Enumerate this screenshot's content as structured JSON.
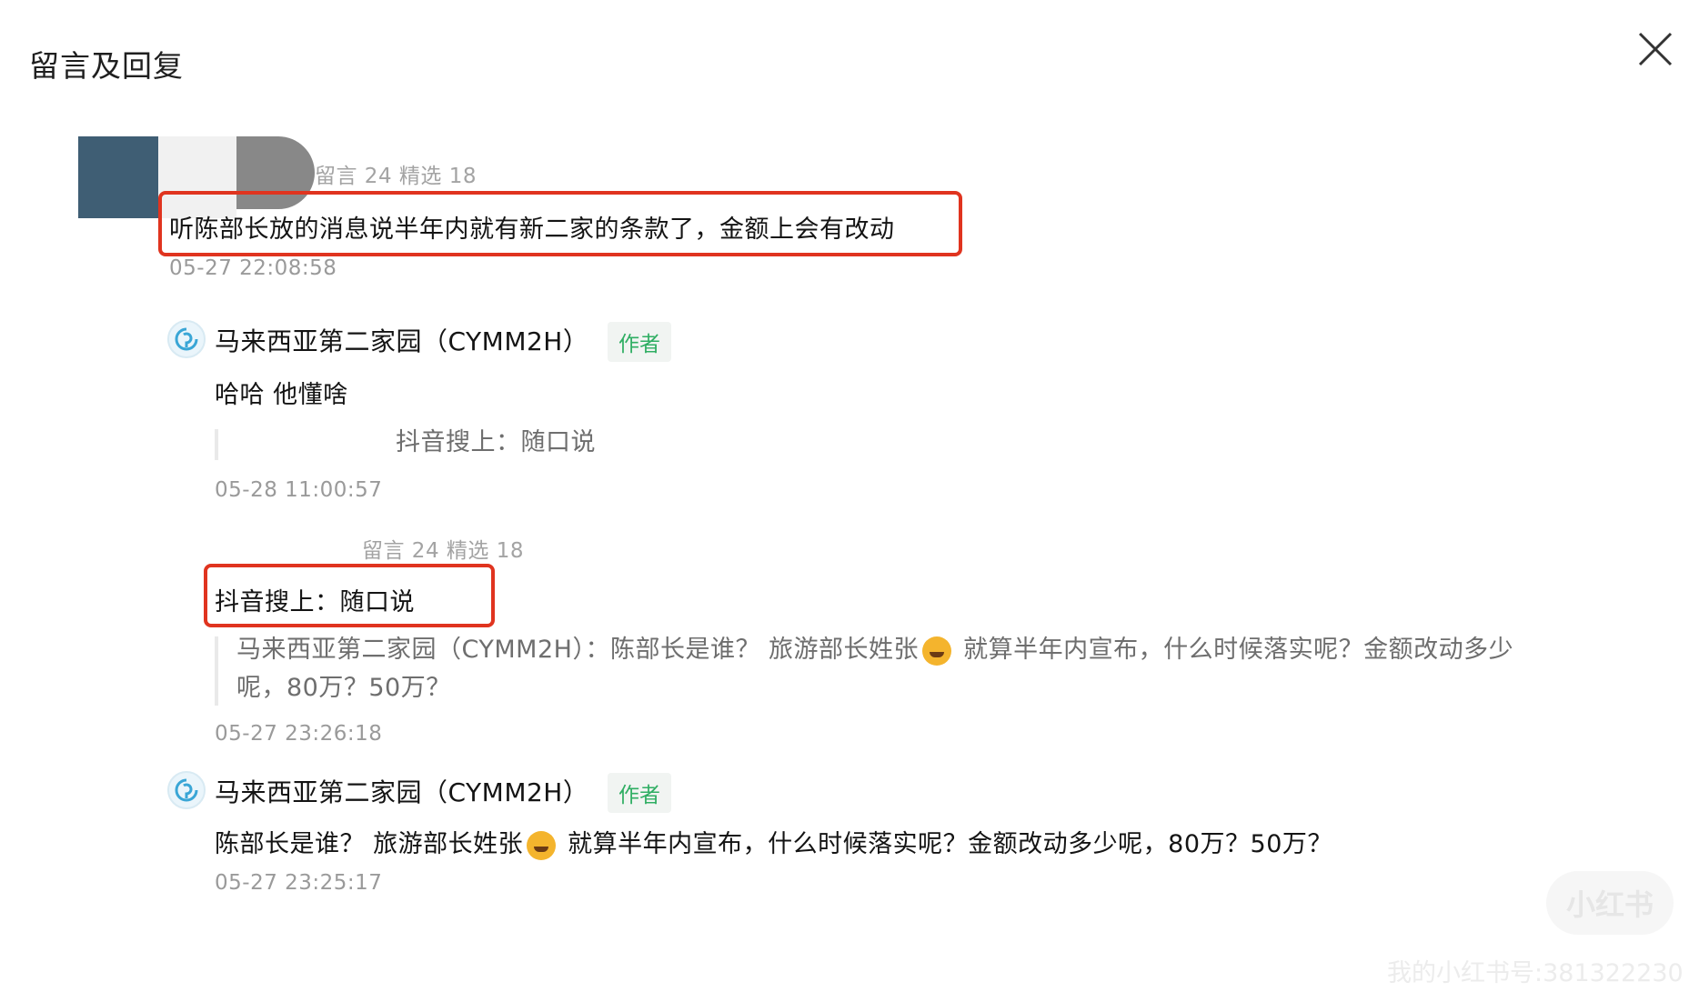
{
  "panel": {
    "title": "留言及回复",
    "close_icon": "close-icon"
  },
  "first_comment": {
    "meta": "留言 24 精选 18",
    "text": "听陈部长放的消息说半年内就有新二家的条款了，金额上会有改动",
    "timestamp": "05-27 22:08:58"
  },
  "author_reply_1": {
    "name": "马来西亚第二家园（CYMM2H）",
    "badge": "作者",
    "text": "哈哈 他懂啥",
    "quote": "抖音搜上：随口说",
    "timestamp": "05-28 11:00:57"
  },
  "second_comment": {
    "meta": "留言 24 精选 18",
    "text": "抖音搜上：随口说",
    "quote_part1": "马来西亚第二家园（CYMM2H）：陈部长是谁？ 旅游部长姓张",
    "quote_part2": " 就算半年内宣布，什么时候落实呢？金额改动多少",
    "quote_part3": "呢，80万？50万？",
    "timestamp": "05-27 23:26:18"
  },
  "author_reply_2": {
    "name": "马来西亚第二家园（CYMM2H）",
    "badge": "作者",
    "text_part1": "陈部长是谁？ 旅游部长姓张",
    "text_part2": " 就算半年内宣布，什么时候落实呢？金额改动多少呢，80万？50万？",
    "timestamp": "05-27 23:25:17"
  },
  "watermark": {
    "logo": "小红书",
    "text": "我的小红书号:381322230"
  },
  "colors": {
    "highlight": "#e0341f",
    "author_badge": "#2fae63"
  }
}
